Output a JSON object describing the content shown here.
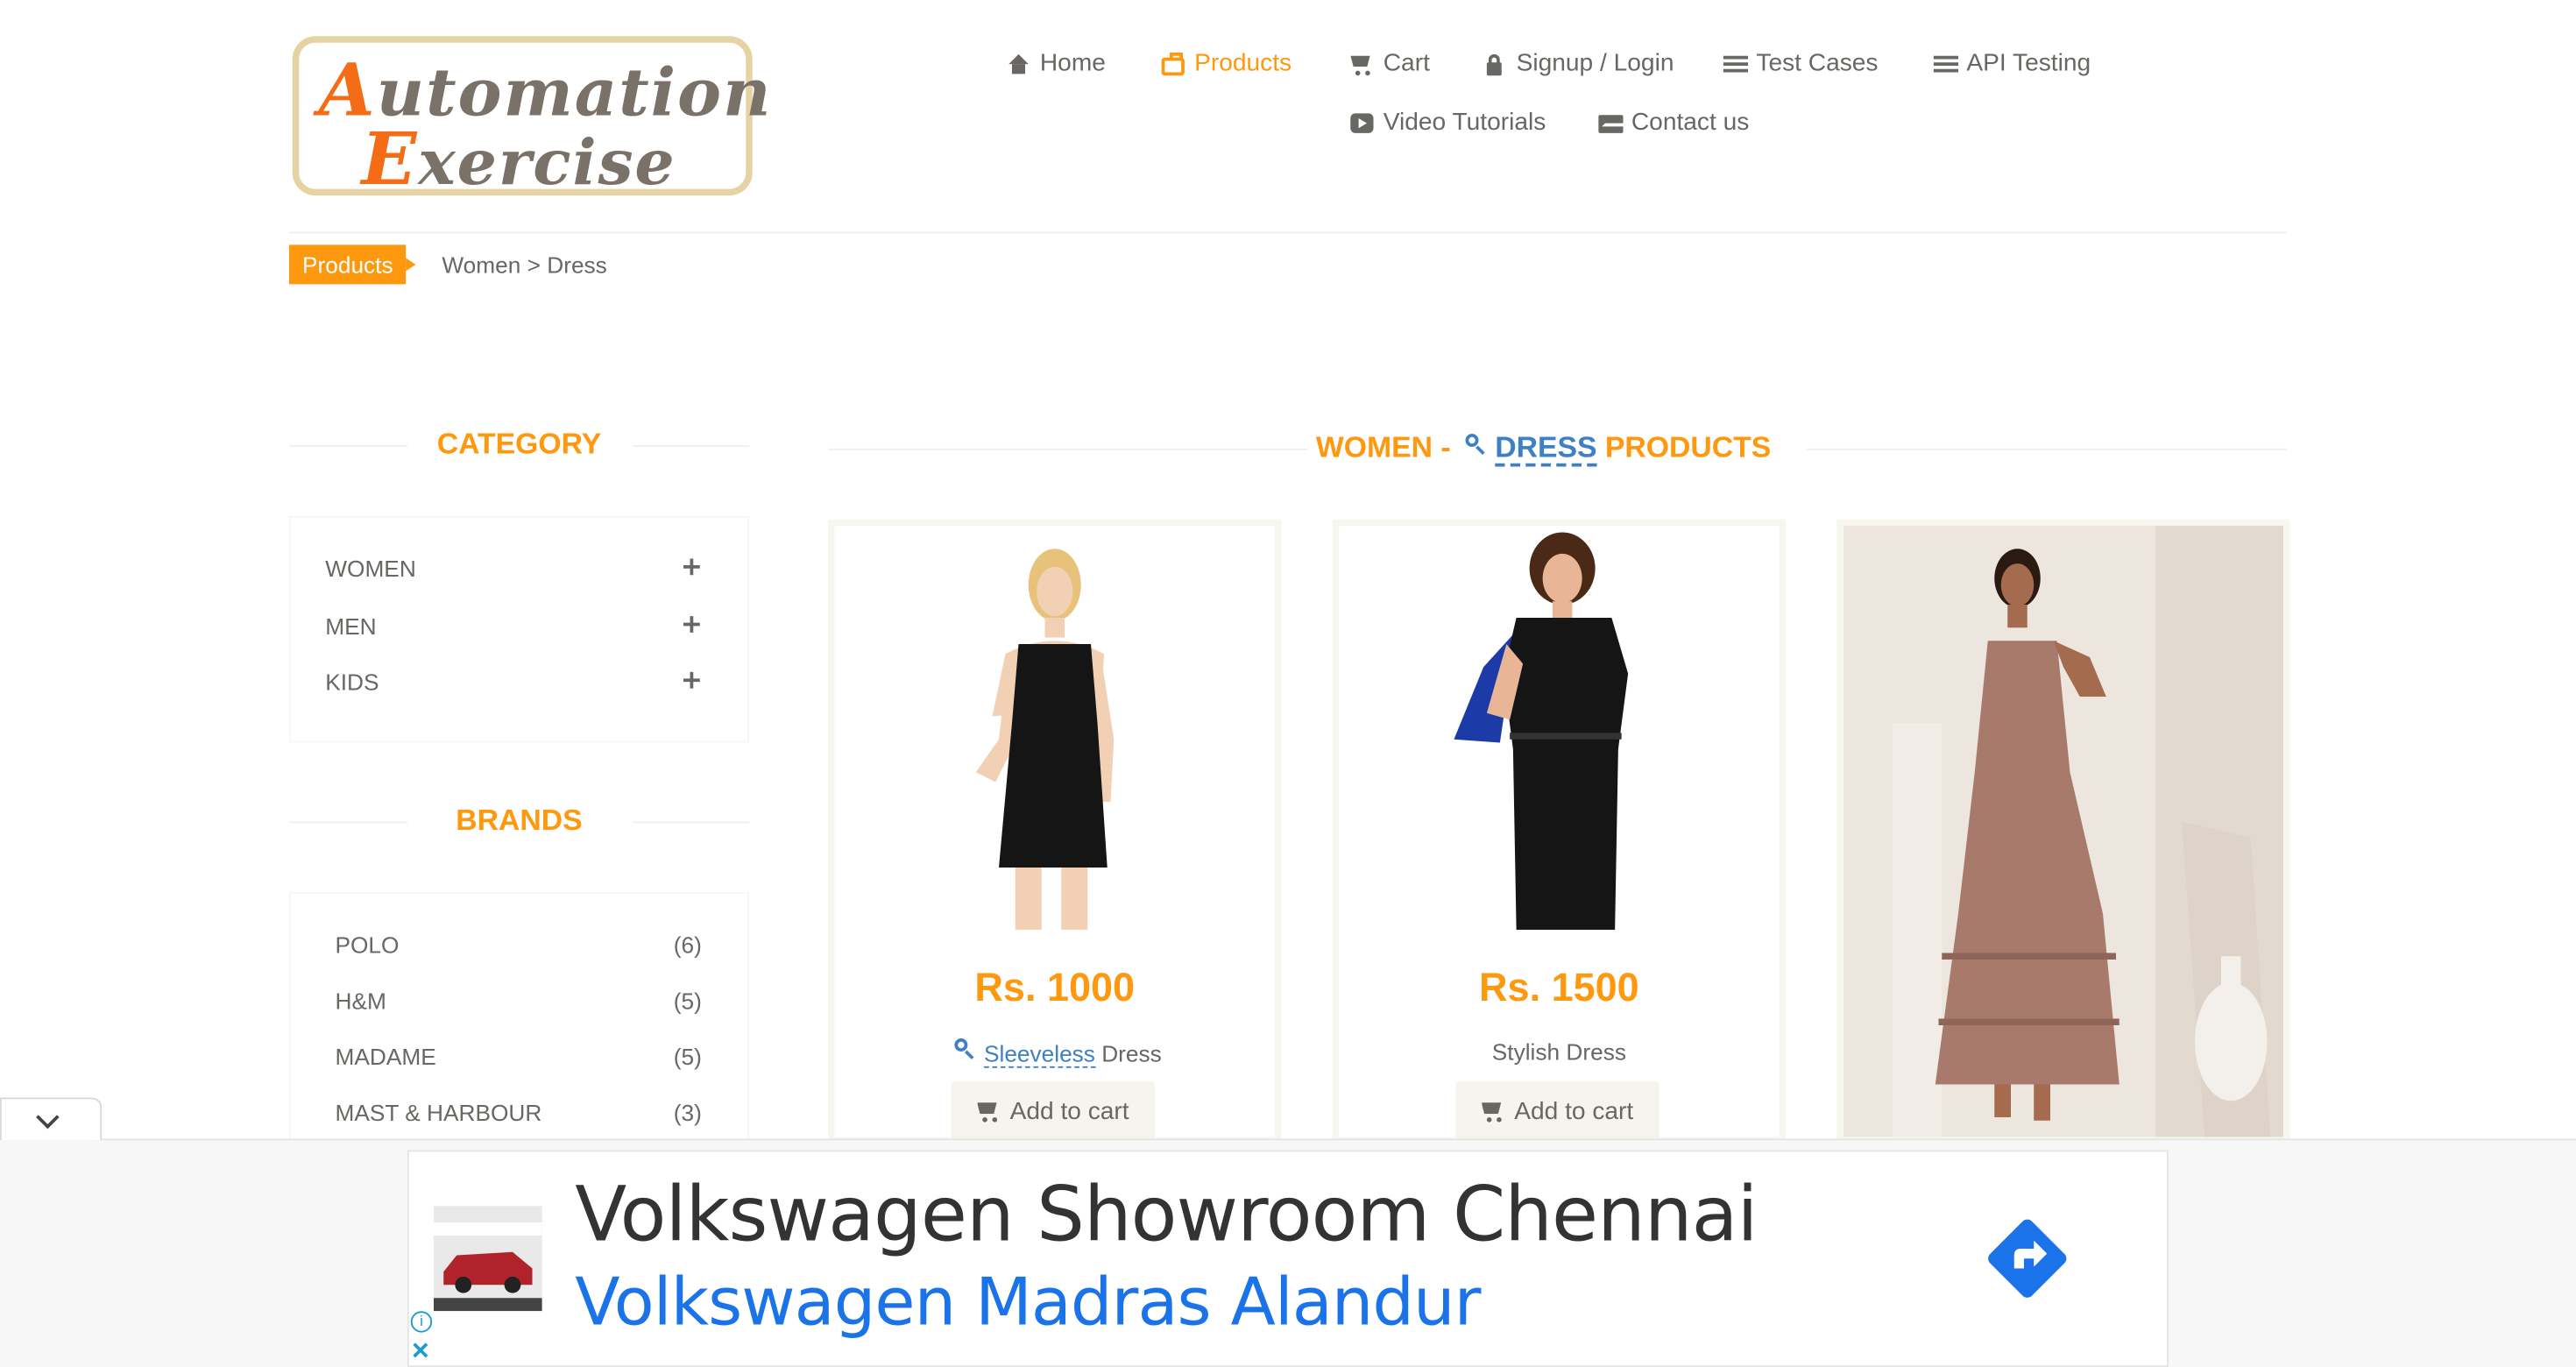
{
  "header": {
    "logo_line1": "Automation",
    "logo_line2": "Exercise",
    "nav": [
      {
        "label": "Home",
        "icon": "home-icon"
      },
      {
        "label": "Products",
        "icon": "briefcase-icon",
        "active": true
      },
      {
        "label": "Cart",
        "icon": "cart-icon"
      },
      {
        "label": "Signup / Login",
        "icon": "lock-icon"
      },
      {
        "label": "Test Cases",
        "icon": "list-icon"
      },
      {
        "label": "API Testing",
        "icon": "list-icon"
      },
      {
        "label": "Video Tutorials",
        "icon": "youtube-icon"
      },
      {
        "label": "Contact us",
        "icon": "envelope-icon"
      }
    ]
  },
  "breadcrumb": {
    "tag": "Products",
    "path": "Women > Dress"
  },
  "sidebar": {
    "category_title": "CATEGORY",
    "categories": [
      "WOMEN",
      "MEN",
      "KIDS"
    ],
    "brands_title": "BRANDS",
    "brands": [
      {
        "name": "POLO",
        "count": "(6)"
      },
      {
        "name": "H&M",
        "count": "(5)"
      },
      {
        "name": "MADAME",
        "count": "(5)"
      },
      {
        "name": "MAST & HARBOUR",
        "count": "(3)"
      }
    ]
  },
  "main": {
    "title_prefix": "WOMEN - ",
    "title_highlight": "DRESS",
    "title_suffix": " PRODUCTS",
    "products": [
      {
        "price": "Rs. 1000",
        "name_highlight": "Sleeveless",
        "name_rest": " Dress",
        "button": "Add to cart"
      },
      {
        "price": "Rs. 1500",
        "name": "Stylish Dress",
        "button": "Add to cart"
      },
      {
        "price": "",
        "name": "",
        "button": ""
      }
    ]
  },
  "ad": {
    "title": "Volkswagen Showroom Chennai",
    "subtitle": "Volkswagen Madras Alandur",
    "info": "i",
    "close": "✕"
  },
  "colors": {
    "accent": "#fe980f",
    "text": "#696763",
    "link": "#3f80c4",
    "ad_link": "#1a73e8"
  }
}
